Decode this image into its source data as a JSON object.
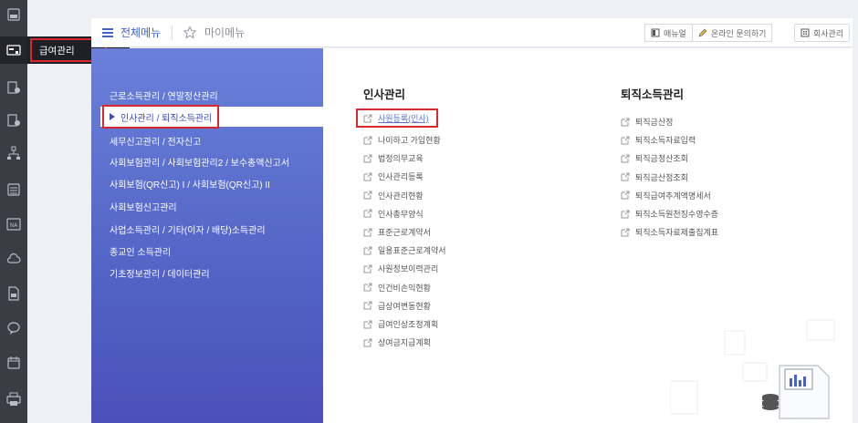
{
  "rail": {
    "icons": [
      {
        "name": "id-card-icon"
      },
      {
        "name": "payroll-icon"
      },
      {
        "name": "doc-settings-icon"
      },
      {
        "name": "doc-settings-2-icon"
      },
      {
        "name": "org-chart-icon"
      },
      {
        "name": "calculator-icon"
      },
      {
        "name": "na-icon"
      },
      {
        "name": "cloud-icon"
      },
      {
        "name": "doc-tax-icon"
      },
      {
        "name": "chat-icon"
      },
      {
        "name": "calendar-icon"
      },
      {
        "name": "printer-icon"
      }
    ],
    "flyout_label": "급여관리"
  },
  "topbar": {
    "all_menu": "전체메뉴",
    "my_menu": "마이메뉴",
    "btn_manual": "매뉴얼",
    "btn_inquiry": "온라인 문의하기",
    "btn_company": "회사관리"
  },
  "categories": [
    "근로소득관리 / 연말정산관리",
    "인사관리 / 퇴직소득관리",
    "세무신고관리 / 전자신고",
    "사회보험관리 / 사회보험관리2 / 보수총액신고서",
    "사회보험(QR신고) I / 사회보험(QR신고) II",
    "사회보험신고관리",
    "사업소득관리 / 기타(이자 / 배당)소득관리",
    "종교인 소득관리",
    "기초정보관리 / 데이터관리"
  ],
  "columns": {
    "hr": {
      "title": "인사관리",
      "items": [
        "사원등록(인사)",
        "나이하고 가입현황",
        "법정의무교육",
        "인사관리등록",
        "인사관리현황",
        "인사총무양식",
        "표준근로계약서",
        "일용표준근로계약서",
        "사원정보이력관리",
        "인건비손익현황",
        "급상여변동현황",
        "급여인상조정계획",
        "상여금지급계획"
      ]
    },
    "retire": {
      "title": "퇴직소득관리",
      "items": [
        "퇴직금산정",
        "퇴직소득자료입력",
        "퇴직금정산조회",
        "퇴직금산정조회",
        "퇴직급여추계액명세서",
        "퇴직소득원천징수영수증",
        "퇴직소득자료제출집계표"
      ]
    }
  },
  "colors": {
    "accent": "#3e63c9",
    "highlight_border": "#d8272d",
    "panel_blue": "#5466c7",
    "rail": "#3b3d44"
  }
}
